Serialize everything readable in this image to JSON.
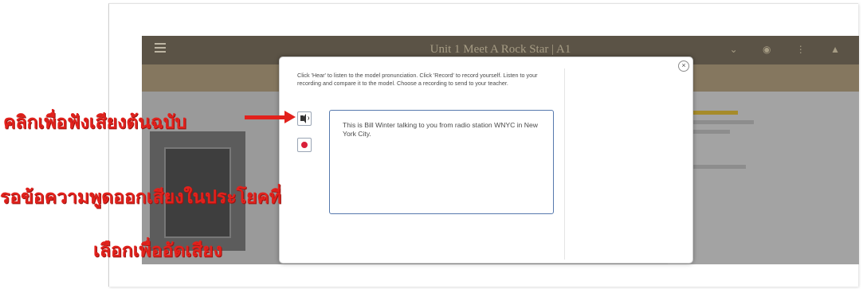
{
  "app": {
    "title": "Unit 1 Meet A Rock Star | A1",
    "header_icons": "⌄ ◉ ⋮ ▲"
  },
  "modal": {
    "close_label": "×",
    "instructions": "Click 'Hear' to listen to the model pronunciation. Click 'Record' to record yourself. Listen to your recording and compare it to the model. Choose a recording to send to your teacher.",
    "sentence": "This is Bill Winter talking to you from radio station WNYC in New York City."
  },
  "annotations": {
    "listen": "คลิกเพื่อฟังเสียงต้นฉบับ",
    "wait": "รอข้อความพูดออกเสียงในประโยคที่",
    "select": "เลือกเพื่ออัดเสียง"
  },
  "colors": {
    "annotation": "#e2211c",
    "record": "#d9203a",
    "textbox_border": "#5679ad"
  }
}
